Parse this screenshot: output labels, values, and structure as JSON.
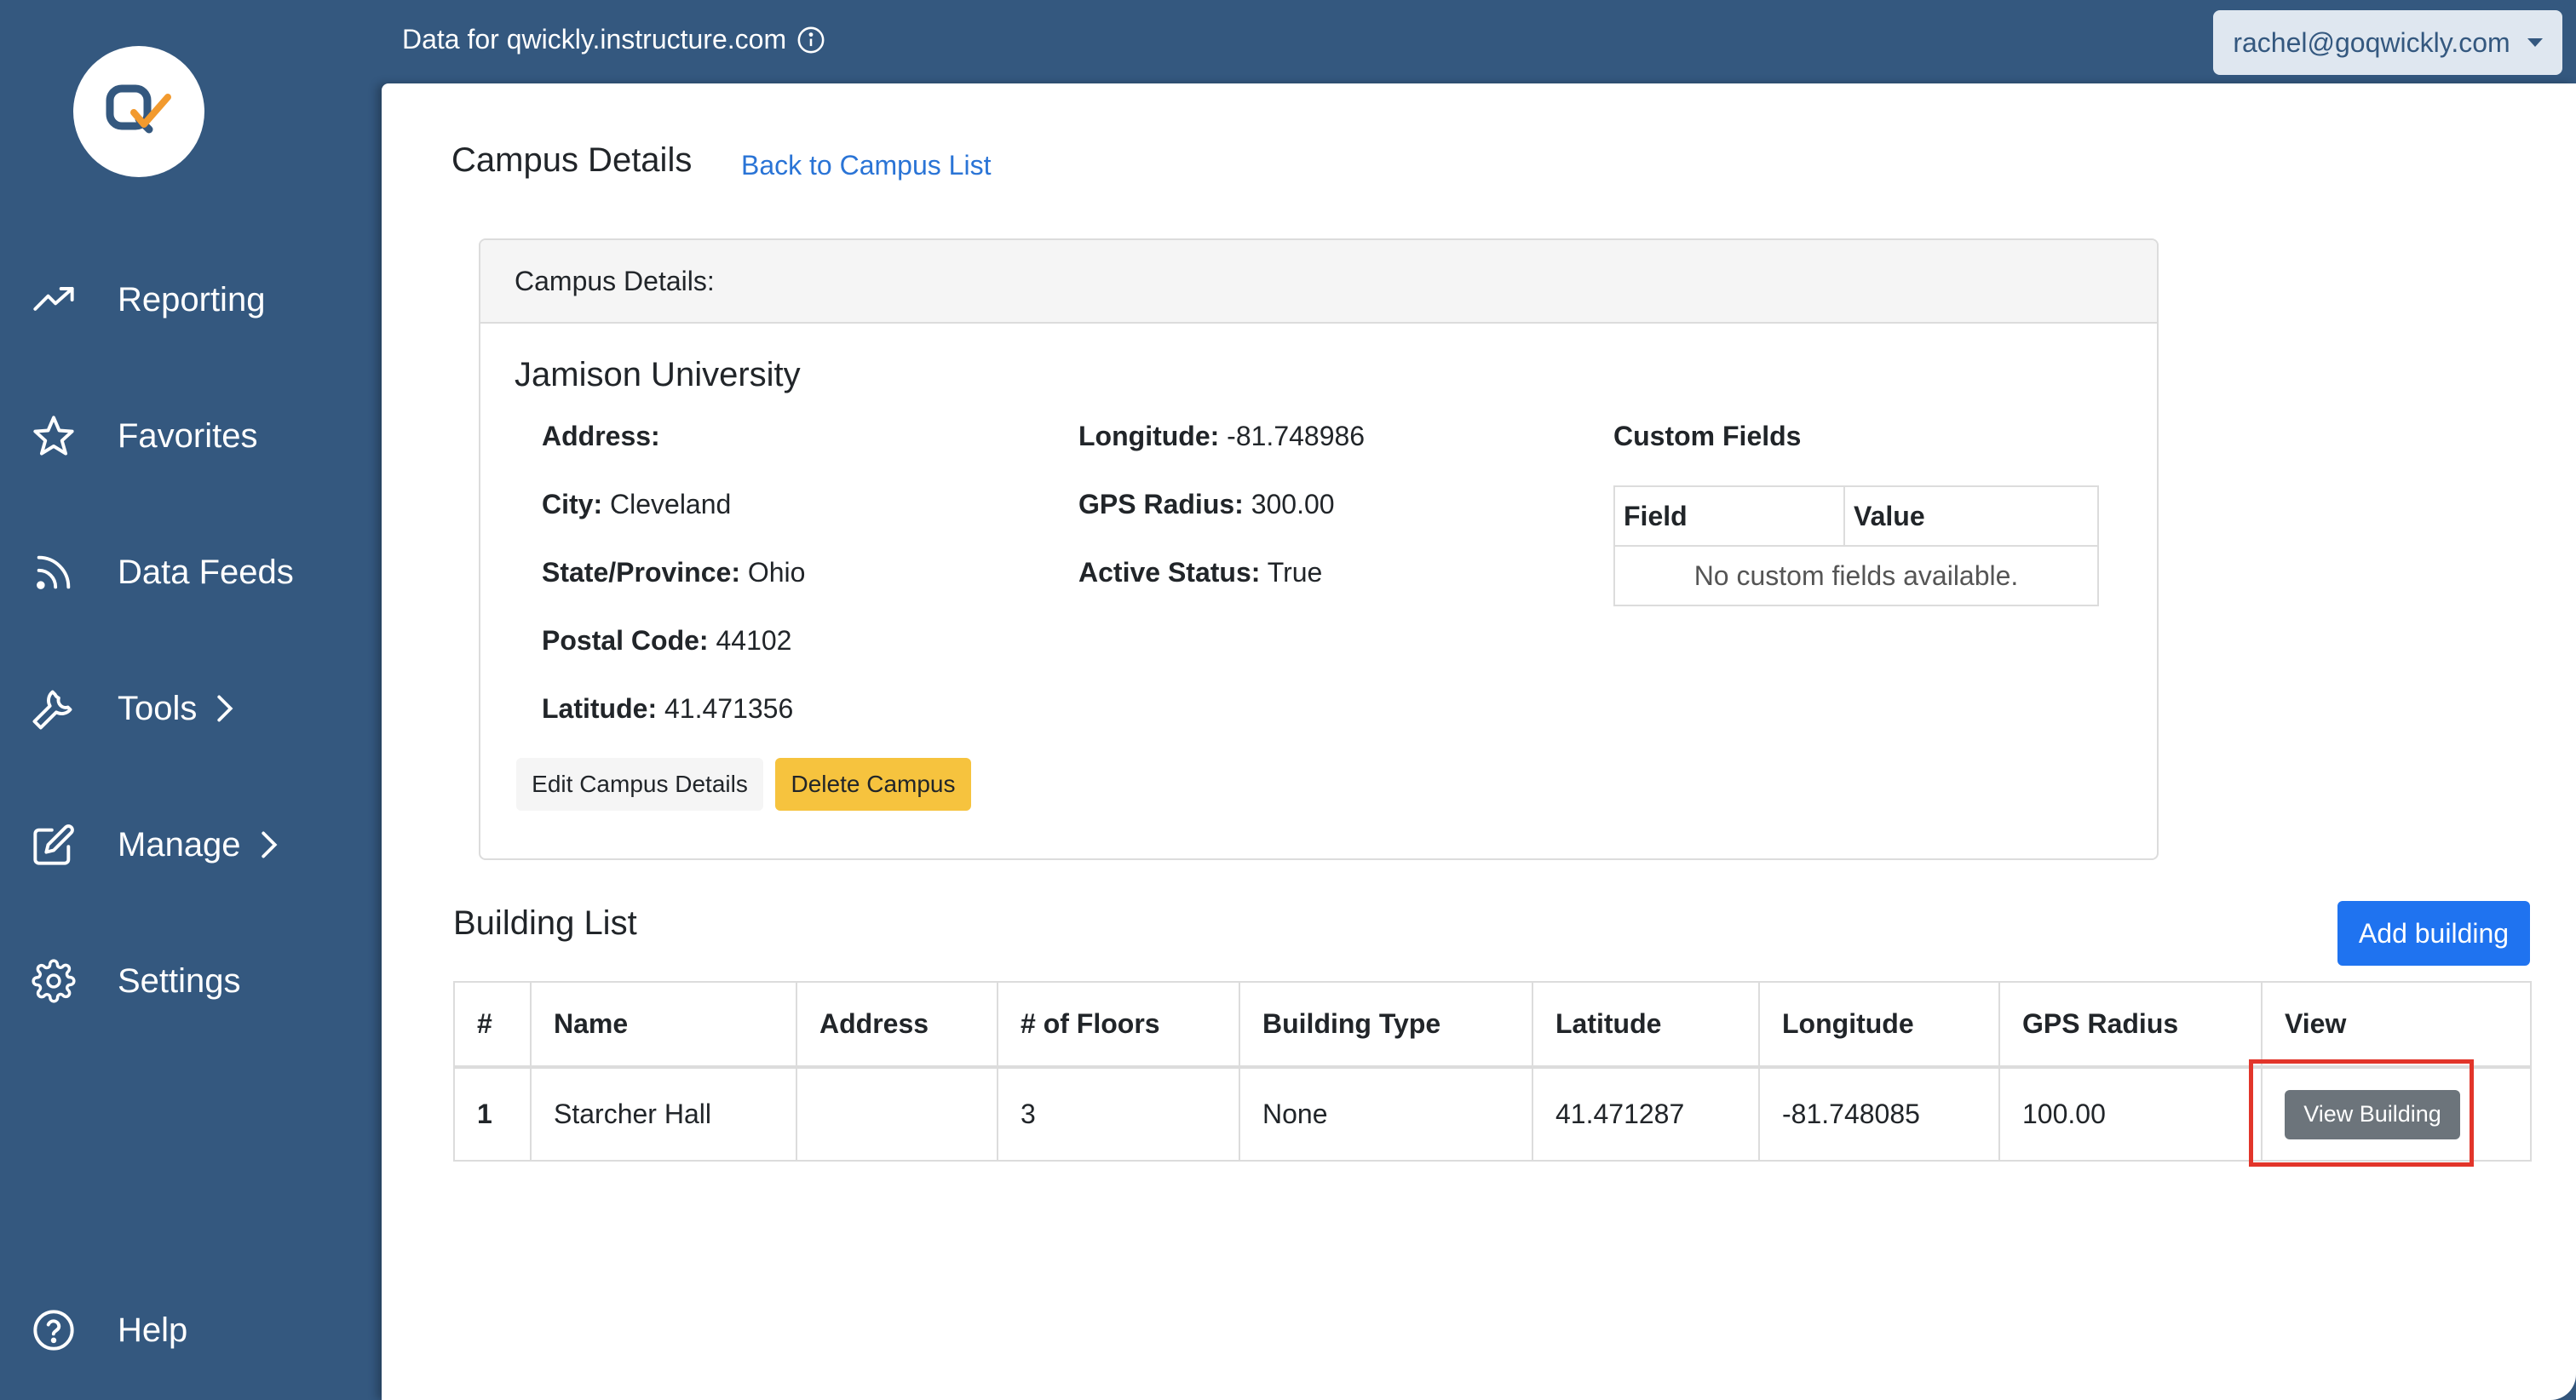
{
  "topbar": {
    "title": "Data for qwickly.instructure.com",
    "account_email": "rachel@goqwickly.com"
  },
  "sidebar": {
    "logo_icon": "qwickly-logo-icon",
    "items": [
      {
        "label": "Reporting",
        "icon": "trending-up-icon"
      },
      {
        "label": "Favorites",
        "icon": "star-icon"
      },
      {
        "label": "Data Feeds",
        "icon": "rss-feed-icon"
      },
      {
        "label": "Tools",
        "icon": "wrench-icon",
        "has_submenu": true
      },
      {
        "label": "Manage",
        "icon": "edit-icon",
        "has_submenu": true
      },
      {
        "label": "Settings",
        "icon": "gear-icon"
      },
      {
        "label": "Help",
        "icon": "help-circle-icon"
      }
    ]
  },
  "page": {
    "title": "Campus Details",
    "back_link": "Back to Campus List"
  },
  "campus_card": {
    "header": "Campus Details:",
    "name": "Jamison University",
    "fields": {
      "address": {
        "label": "Address:",
        "value": ""
      },
      "city": {
        "label": "City:",
        "value": "Cleveland"
      },
      "state": {
        "label": "State/Province:",
        "value": "Ohio"
      },
      "postal": {
        "label": "Postal Code:",
        "value": "44102"
      },
      "latitude": {
        "label": "Latitude:",
        "value": "41.471356"
      },
      "longitude": {
        "label": "Longitude:",
        "value": "-81.748986"
      },
      "gps_radius": {
        "label": "GPS Radius:",
        "value": "300.00"
      },
      "active": {
        "label": "Active Status:",
        "value": "True"
      }
    },
    "custom_fields": {
      "title": "Custom Fields",
      "columns": [
        "Field",
        "Value"
      ],
      "empty_message": "No custom fields available."
    },
    "edit_button": "Edit Campus Details",
    "delete_button": "Delete Campus"
  },
  "building_list": {
    "title": "Building List",
    "add_button": "Add building",
    "columns": [
      "#",
      "Name",
      "Address",
      "# of Floors",
      "Building Type",
      "Latitude",
      "Longitude",
      "GPS Radius",
      "View"
    ],
    "rows": [
      {
        "index": "1",
        "name": "Starcher Hall",
        "address": "",
        "floors": "3",
        "type": "None",
        "latitude": "41.471287",
        "longitude": "-81.748085",
        "gps_radius": "100.00",
        "view_button": "View Building"
      }
    ]
  },
  "colors": {
    "sidebar_bg": "#34587f",
    "primary": "#1f73f0",
    "warning": "#f6c33e",
    "secondary": "#6c747b",
    "link": "#2a74d6",
    "highlight": "#e2352a",
    "logo_orange": "#f29a2e"
  }
}
